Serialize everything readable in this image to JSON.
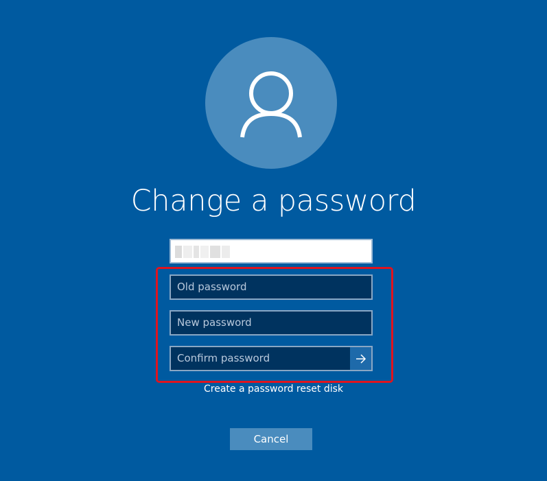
{
  "screen": {
    "title": "Change a password",
    "background_color": "#005aa0",
    "avatar_icon": "user-icon"
  },
  "form": {
    "old_password_placeholder": "Old password",
    "new_password_placeholder": "New password",
    "confirm_password_placeholder": "Confirm password",
    "submit_icon": "arrow-right-icon"
  },
  "links": {
    "reset_disk": "Create a password reset disk"
  },
  "actions": {
    "cancel_label": "Cancel"
  },
  "colors": {
    "highlight": "#e0141e",
    "field_fill": "#00335f",
    "avatar_fill": "#4a8cbe"
  }
}
